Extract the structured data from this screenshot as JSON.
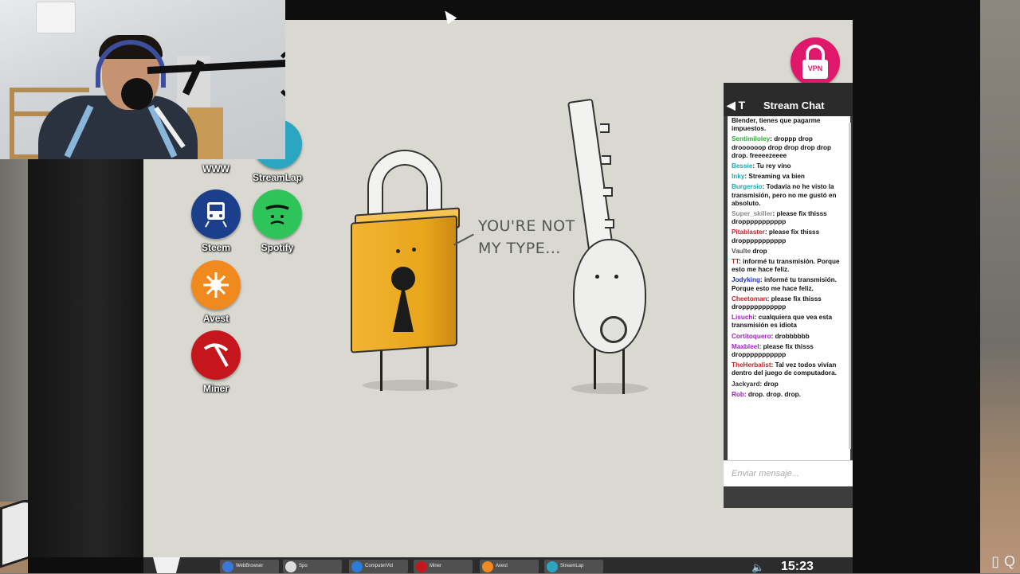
{
  "desktop_icons": [
    {
      "label": "WWW",
      "icon": "globe-icon"
    },
    {
      "label": "StreamLap",
      "icon": "streamlap-icon"
    },
    {
      "label": "Steem",
      "icon": "train-icon",
      "color": "#1c3f8c"
    },
    {
      "label": "Spotify",
      "icon": "spotify-icon",
      "color": "#2fc45a"
    },
    {
      "label": "Avest",
      "icon": "virus-icon",
      "color": "#f08a1e"
    },
    {
      "label": "Miner",
      "icon": "pickaxe-icon",
      "color": "#c4161c"
    }
  ],
  "wallpaper": {
    "speech": "YOU'RE NOT\nMY TYPE..."
  },
  "vpn": {
    "label": "VPN",
    "color": "#e0186c"
  },
  "chat": {
    "title": "Stream Chat",
    "back_label": "T",
    "input_placeholder": "Enviar mensaje...",
    "messages": [
      {
        "user": "",
        "color": "#111111",
        "text": "Blender, tienes que pagarme impuestos."
      },
      {
        "user": "Sentimiloley",
        "color": "#2eaa3a",
        "text": ": droppp drop droooooop drop drop drop drop drop. freeeezeeee"
      },
      {
        "user": "Bessie",
        "color": "#1aa6a6",
        "text": ": Tu rey vino"
      },
      {
        "user": "Inky",
        "color": "#1aa6a6",
        "text": ": Streaming va bien"
      },
      {
        "user": "Burgersio",
        "color": "#1aa6a6",
        "text": ": Todavía no he visto la transmisión, pero no me gustó en absoluto."
      },
      {
        "user": "Super_skiller",
        "color": "#888888",
        "text": ": please fix thisss droppppppppppp"
      },
      {
        "user": "Pitablaster",
        "color": "#c0202a",
        "text": ": please fix thisss droppppppppppp"
      },
      {
        "user": "Vaulte",
        "color": "#555555",
        "text": " drop"
      },
      {
        "user": "TT",
        "color": "#c0202a",
        "text": ": informé tu transmisión. Porque esto me hace feliz."
      },
      {
        "user": "Jodyking",
        "color": "#2030c0",
        "text": ": informé tu transmisión. Porque esto me hace feliz."
      },
      {
        "user": "Cheetoman",
        "color": "#c0202a",
        "text": ": please fix thisss droppppppppppp"
      },
      {
        "user": "Lisuchi",
        "color": "#a020c0",
        "text": ": cualquiera que vea esta transmisión es idiota"
      },
      {
        "user": "Cortitoquero",
        "color": "#a020c0",
        "text": ": drobbbbbb"
      },
      {
        "user": "Maxbleel",
        "color": "#a020c0",
        "text": ": please fix thisss droppppppppppp"
      },
      {
        "user": "TheHerbalist",
        "color": "#c0202a",
        "text": ": Tal vez todos vivían dentro del juego de computadora."
      },
      {
        "user": "Jackyard",
        "color": "#333333",
        "text": ": drop"
      },
      {
        "user": "Rob",
        "color": "#a020c0",
        "text": ": drop. drop. drop."
      }
    ]
  },
  "taskbar": {
    "items": [
      {
        "label": "WebBrowser",
        "icon": "globe-icon",
        "color": "#3a78d8"
      },
      {
        "label": "Spo",
        "icon": "spotify-icon",
        "color": "#dddddd"
      },
      {
        "label": "ComputerVid",
        "icon": "monitor-icon",
        "color": "#2a7ad8"
      },
      {
        "label": "Miner",
        "icon": "pickaxe-icon",
        "color": "#c4161c"
      },
      {
        "label": "Avest",
        "icon": "virus-icon",
        "color": "#f08a1e"
      },
      {
        "label": "StreamLap",
        "icon": "streamlap-icon",
        "color": "#2aa6c0"
      }
    ],
    "clock": "15:23"
  }
}
